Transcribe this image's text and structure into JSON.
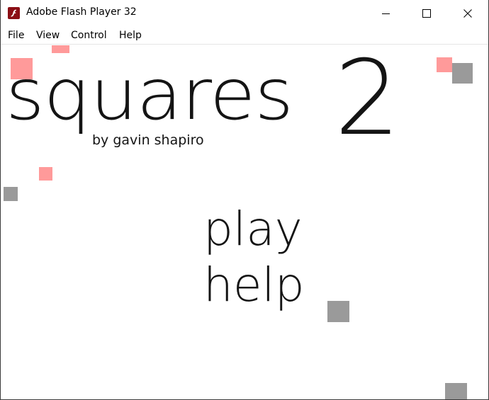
{
  "window": {
    "title": "Adobe Flash Player 32",
    "icon": "flash-player-icon",
    "controls": [
      "minimize-icon",
      "maximize-icon",
      "close-icon"
    ]
  },
  "menubar": {
    "items": [
      "File",
      "View",
      "Control",
      "Help"
    ]
  },
  "game": {
    "title": "squares",
    "number": "2",
    "byline": "by gavin shapiro",
    "options": [
      "play",
      "help"
    ],
    "colors": {
      "background": "#ffffff",
      "text": "#141414",
      "pink_square": "#ff9a9a",
      "gray_square": "#9a9a9a",
      "icon_red": "#8b0f15"
    }
  }
}
